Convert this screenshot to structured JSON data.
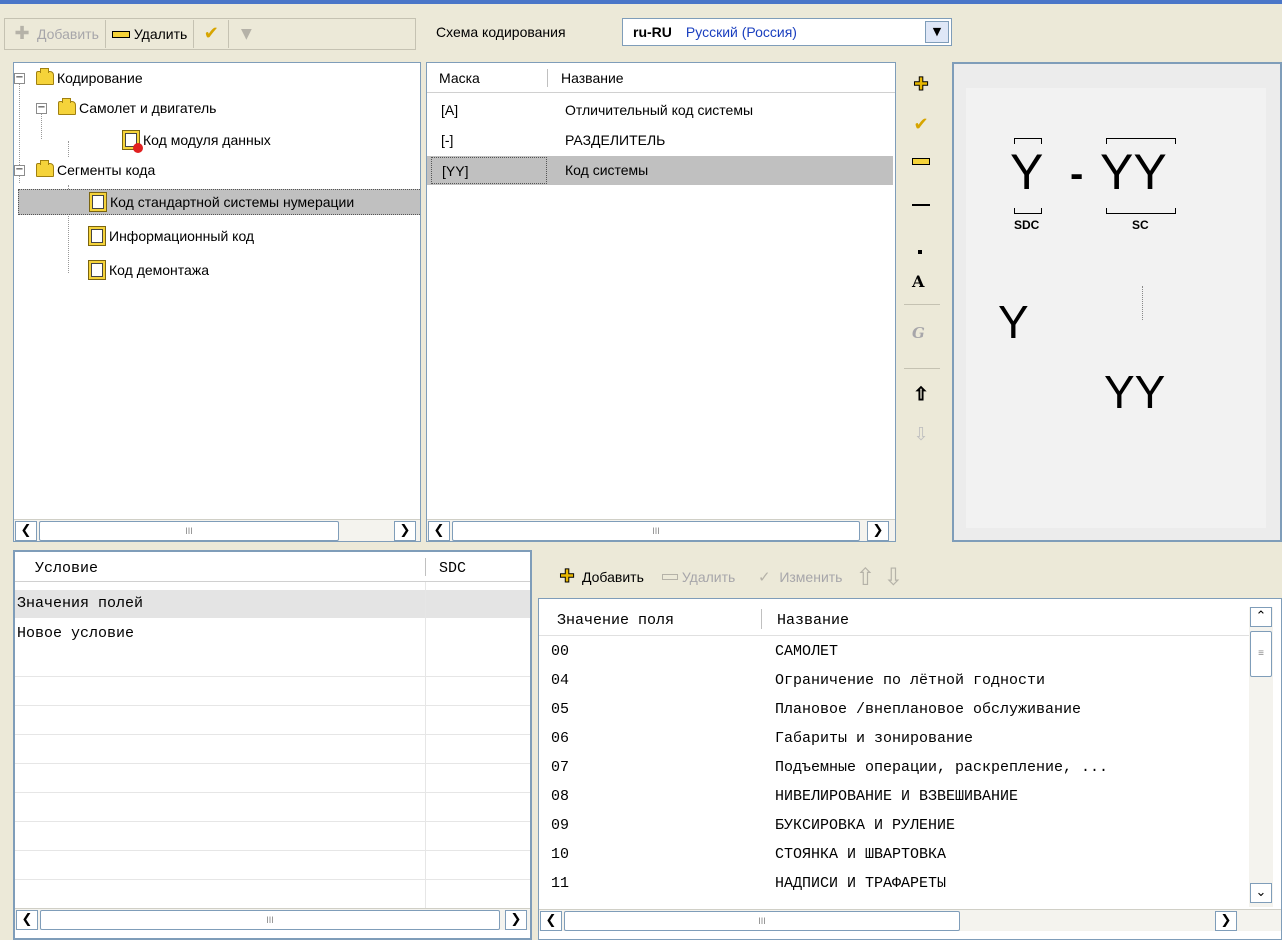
{
  "left_toolbar": {
    "add": "Добавить",
    "delete": "Удалить"
  },
  "encoding": {
    "label": "Схема кодирования",
    "code": "ru-RU",
    "name": "Русский (Россия)"
  },
  "tree": {
    "items": [
      {
        "label": "Кодирование"
      },
      {
        "label": "Самолет и двигатель"
      },
      {
        "label": "Код модуля данных"
      },
      {
        "label": "Сегменты кода"
      },
      {
        "label": "Код стандартной системы нумерации"
      },
      {
        "label": "Информационный код"
      },
      {
        "label": "Код демонтажа"
      }
    ]
  },
  "mask_table": {
    "headers": {
      "mask": "Маска",
      "name": "Название"
    },
    "rows": [
      {
        "mask": "[A]",
        "name": "Отличительный код системы"
      },
      {
        "mask": "[-]",
        "name": "РАЗДЕЛИТЕЛЬ"
      },
      {
        "mask": "[YY]",
        "name": "Код системы"
      }
    ]
  },
  "preview": {
    "sdc_char": "Y",
    "dash": "-",
    "sc_chars": "YY",
    "sdc_label": "SDC",
    "sc_label": "SC",
    "col1_char": "Y",
    "col2_chars": "YY"
  },
  "conditions": {
    "headers": {
      "condition": "Условие",
      "sdc": "SDC"
    },
    "rows": [
      {
        "condition": "Значения полей"
      },
      {
        "condition": "Новое условие"
      }
    ]
  },
  "values_toolbar": {
    "add": "Добавить",
    "delete": "Удалить",
    "edit": "Изменить"
  },
  "values_table": {
    "headers": {
      "value": "Значение поля",
      "name": "Название"
    },
    "rows": [
      {
        "value": "00",
        "name": "САМОЛЕТ"
      },
      {
        "value": "04",
        "name": "Ограничение по лётной годности"
      },
      {
        "value": "05",
        "name": "Плановое /внеплановое обслуживание"
      },
      {
        "value": "06",
        "name": "Габариты и зонирование"
      },
      {
        "value": "07",
        "name": "Подъемные операции, раскрепление, ..."
      },
      {
        "value": "08",
        "name": "НИВЕЛИРОВАНИЕ И ВЗВЕШИВАНИЕ"
      },
      {
        "value": "09",
        "name": "БУКСИРОВКА И РУЛЕНИЕ"
      },
      {
        "value": "10",
        "name": "СТОЯНКА И ШВАРТОВКА"
      },
      {
        "value": "11",
        "name": "НАДПИСИ И ТРАФАРЕТЫ"
      }
    ]
  },
  "scrollbar": {
    "grip": "III"
  },
  "colors": {
    "selection": "#c0c0c0",
    "encoding_name": "#1a3fbf",
    "border": "#7f9db9",
    "window": "#ece9d8"
  }
}
